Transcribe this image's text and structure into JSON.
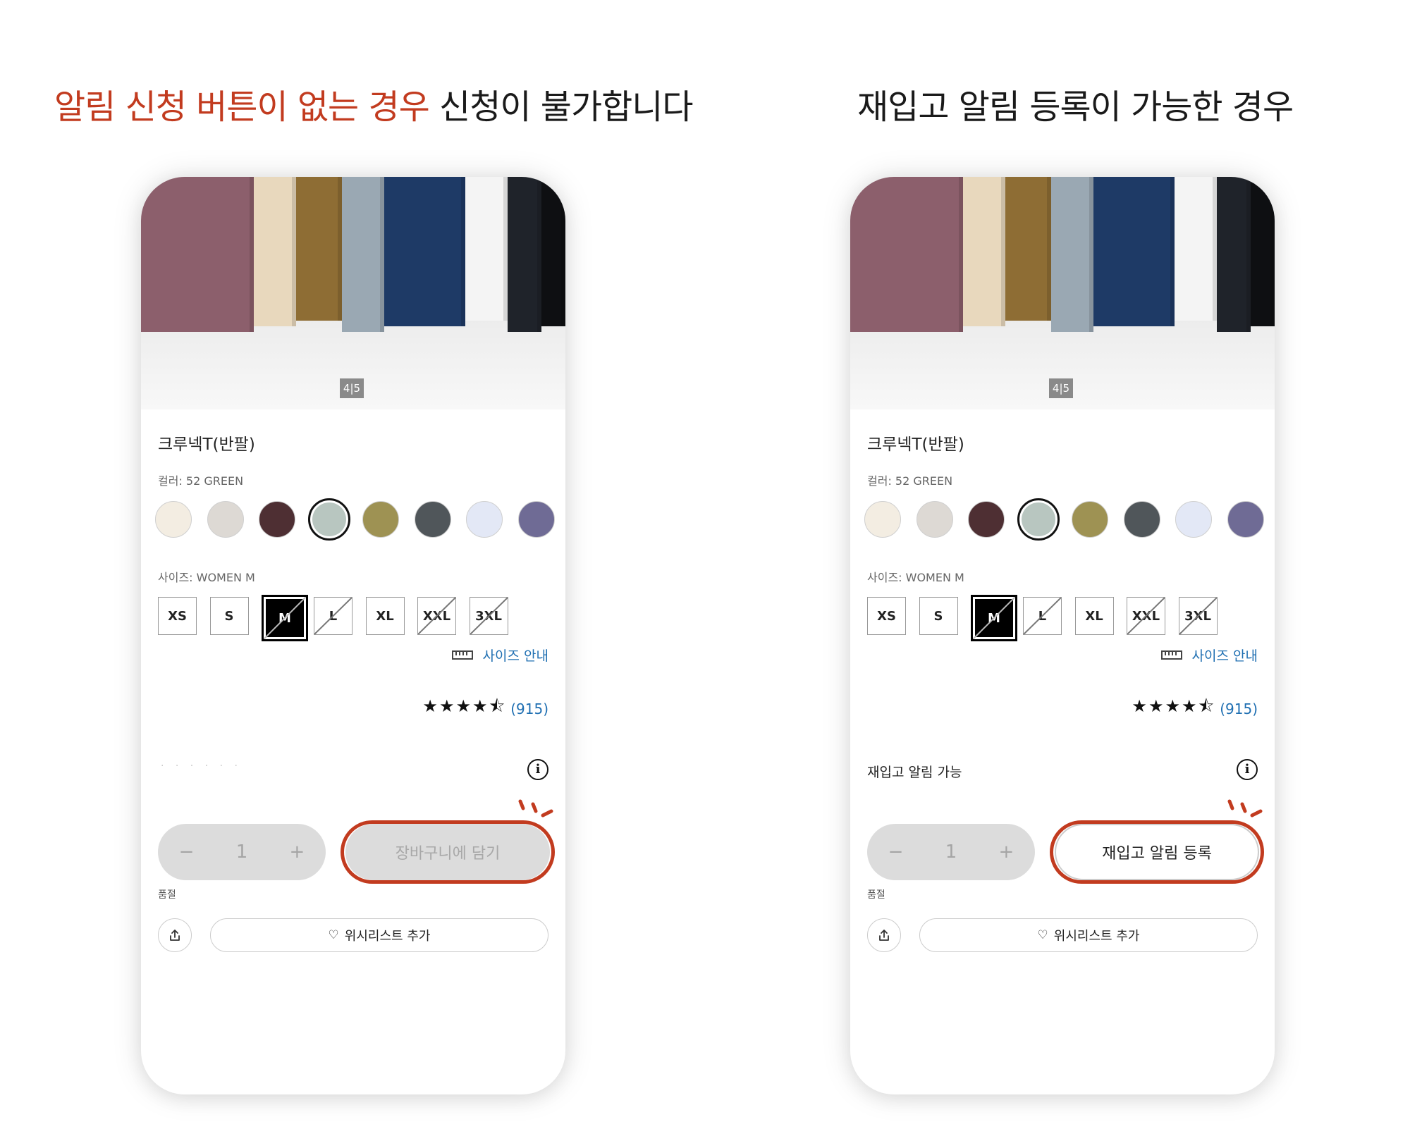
{
  "headings": {
    "left_accent": "알림 신청 버튼이 없는 경우",
    "left_rest": " 신청이 불가합니다",
    "right": "재입고 알림 등록이 가능한 경우"
  },
  "accent_color": "#c23b1f",
  "product": {
    "pager": "4|5",
    "name": "크루넥T(반팔)",
    "color_label": "컬러: 52 GREEN",
    "swatches": [
      "#f3ede2",
      "#ddd9d4",
      "#4e2f33",
      "#b8c6c0",
      "#9e9253",
      "#50565a",
      "#e3e8f6",
      "#6f6b95"
    ],
    "selected_swatch": 3,
    "size_label": "사이즈: WOMEN M",
    "sizes": [
      "XS",
      "S",
      "M",
      "L",
      "XL",
      "XXL",
      "3XL"
    ],
    "selected_size": "M",
    "unavailable_sizes": [
      "M",
      "L",
      "XXL",
      "3XL"
    ],
    "size_guide": "사이즈 안내",
    "size_guide_icon": "ruler-icon",
    "stars": "★★★★⯪",
    "rating_value": 4.5,
    "rating_count": "(915)",
    "quantity": {
      "minus": "−",
      "value": "1",
      "plus": "+"
    },
    "soldout_label": "품절",
    "wishlist_label": "위시리스트 추가",
    "wishlist_icon": "heart-icon",
    "share_icon": "share-icon",
    "info_icon": "info-icon"
  },
  "phone_left": {
    "restock_text": "· · ·   · · ·",
    "cta_label": "장바구니에 담기",
    "cta_state": "disabled"
  },
  "phone_right": {
    "restock_text": "재입고 알림 가능",
    "cta_label": "재입고 알림 등록",
    "cta_state": "active"
  }
}
